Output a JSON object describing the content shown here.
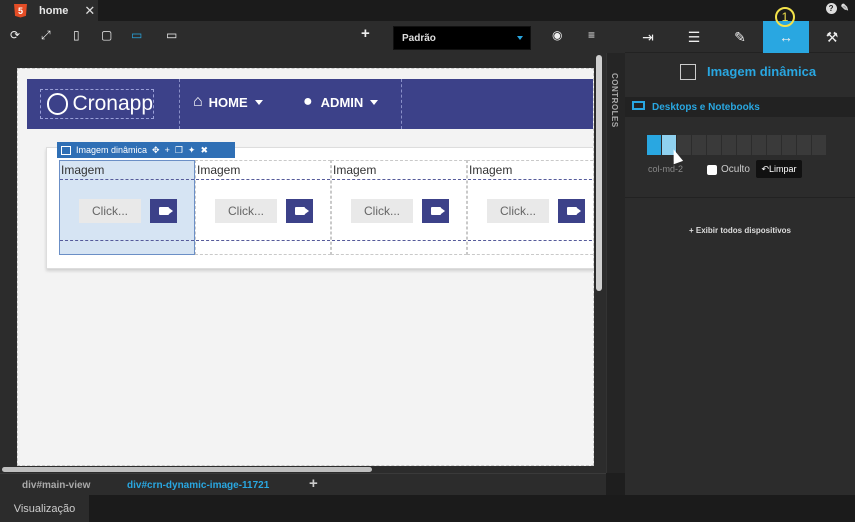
{
  "tabs": {
    "active_tab": "home",
    "html5_badge": "5"
  },
  "toolbar": {
    "icons": [
      "refresh-icon",
      "expand-icon",
      "mobile-icon",
      "tablet-icon",
      "desktop-icon",
      "monitor-icon",
      "add-icon",
      "eye-off-icon",
      "database-icon"
    ],
    "device_select": "Padrão"
  },
  "canvas": {
    "brand": "Cronapp",
    "nav": [
      {
        "label": "HOME",
        "icon": "home-icon"
      },
      {
        "label": "ADMIN",
        "icon": "user-icon"
      }
    ],
    "selection_label": "Imagem dinâmica",
    "image_columns": [
      {
        "title": "Imagem",
        "click_label": "Click...",
        "selected": true
      },
      {
        "title": "Imagem",
        "click_label": "Click...",
        "selected": false
      },
      {
        "title": "Imagem",
        "click_label": "Click...",
        "selected": false
      },
      {
        "title": "Imagem",
        "click_label": "Click...",
        "selected": false
      }
    ],
    "side_label": "CONTROLES"
  },
  "breadcrumb": {
    "root": "div#main-view",
    "current": "div#crn-dynamic-image-11721"
  },
  "statusbar": {
    "visualizacao": "Visualização"
  },
  "panel": {
    "annotation_number": "1",
    "component_title": "Imagem dinâmica",
    "device_label": "Desktops e Notebooks",
    "columns_selected": 2,
    "columns_total": 12,
    "col_label": "col-md-2",
    "hidden_label": "Oculto",
    "clear_label": "Limpar",
    "show_all_label": "+ Exibir todos dispositivos"
  },
  "colors": {
    "accent": "#29a7e1",
    "navbar": "#3c4189",
    "annotation": "#f3e24a"
  }
}
